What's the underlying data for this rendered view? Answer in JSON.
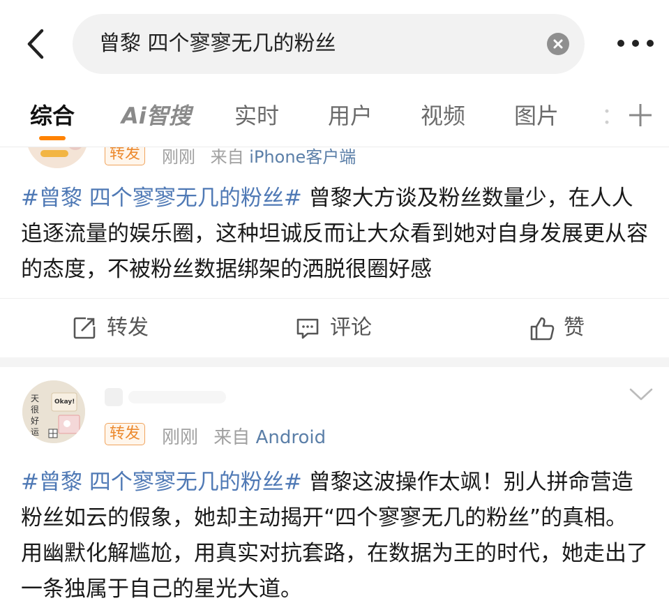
{
  "search": {
    "query": "曾黎 四个寥寥无几的粉丝"
  },
  "tabs": [
    {
      "label": "综合"
    },
    {
      "label": "Ai智搜"
    },
    {
      "label": "实时"
    },
    {
      "label": "用户"
    },
    {
      "label": "视频"
    },
    {
      "label": "图片"
    }
  ],
  "tab_overflow": "：",
  "colors": {
    "accent": "#ff8200",
    "hashtag": "#4f79b5",
    "badge": "#ec8a2f"
  },
  "posts": [
    {
      "badge": "转发",
      "time": "刚刚",
      "source_prefix": "来自",
      "source": "iPhone客户端",
      "hashtag": "#曾黎 四个寥寥无几的粉丝#",
      "body": " 曾黎大方谈及粉丝数量少，在人人追逐流量的娱乐圈，这种坦诚反而让大众看到她对自身发展更从容的态度，不被粉丝数据绑架的洒脱很圈好感",
      "actions": {
        "repost": "转发",
        "comment": "评论",
        "like": "赞"
      }
    },
    {
      "badge": "转发",
      "time": "刚刚",
      "source_prefix": "来自",
      "source": "Android",
      "avatar_text": {
        "line1": "天",
        "line2": "很",
        "line3": "好",
        "line4": "运",
        "sticker": "Okay!"
      },
      "hashtag": "#曾黎 四个寥寥无几的粉丝#",
      "body": " 曾黎这波操作太飒！别人拼命营造粉丝如云的假象，她却主动揭开“四个寥寥无几的粉丝”的真相。用幽默化解尴尬，用真实对抗套路，在数据为王的时代，她走出了一条独属于自己的星光大道。"
    }
  ]
}
